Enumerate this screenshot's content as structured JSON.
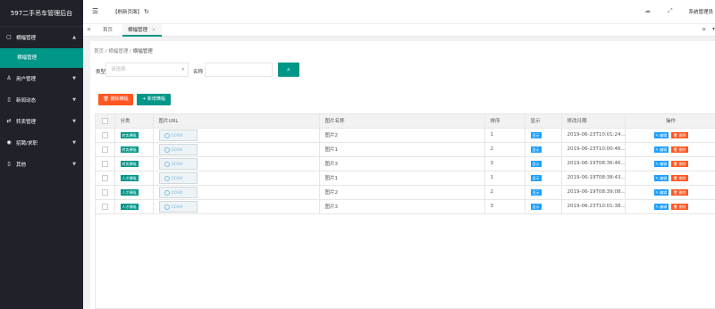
{
  "app": {
    "title": "597二手吊车管理后台"
  },
  "sidebar": {
    "items": [
      {
        "label": "横幅管理",
        "icon": "file-icon",
        "arrow": "▲",
        "open": true
      },
      {
        "label": "用户管理",
        "icon": "user-icon",
        "arrow": "▼"
      },
      {
        "label": "新闻动态",
        "icon": "doc-icon",
        "arrow": "▼"
      },
      {
        "label": "转卖管理",
        "icon": "transfer-icon",
        "arrow": "▼"
      },
      {
        "label": "招聘/求职",
        "icon": "circle-icon",
        "arrow": "▼"
      },
      {
        "label": "其他",
        "icon": "doc-icon",
        "arrow": "▼"
      }
    ],
    "subitem": "横幅管理"
  },
  "header": {
    "refresh_label": "【刷新页面】",
    "sys_label": "系统管理员"
  },
  "tabs": {
    "home": "首页",
    "active": "横幅管理"
  },
  "breadcrumb": {
    "a": "首页",
    "b": "横幅管理",
    "c": "横幅管理",
    "sep": "/"
  },
  "filter": {
    "type_label": "类型",
    "type_placeholder": "请选择",
    "name_label": "名称"
  },
  "buttons": {
    "batch_delete": "删除横幅",
    "add": "新增横幅"
  },
  "table": {
    "headers": [
      "",
      "分类",
      "图片URL",
      "图片名称",
      "排序",
      "显示",
      "修改日期",
      "操作"
    ],
    "rows": [
      {
        "category": "转卖横幅",
        "name": "图片2",
        "order": "1",
        "show": "显示",
        "date": "2019-06-23T10:01:24...",
        "edit": "编辑",
        "del": "删除"
      },
      {
        "category": "转卖横幅",
        "name": "图片1",
        "order": "2",
        "show": "显示",
        "date": "2019-06-23T10:00:46...",
        "edit": "编辑",
        "del": "删除"
      },
      {
        "category": "转卖横幅",
        "name": "图片3",
        "order": "3",
        "show": "显示",
        "date": "2019-06-19T08:36:46...",
        "edit": "编辑",
        "del": "删除"
      },
      {
        "category": "人才横幅",
        "name": "图片1",
        "order": "1",
        "show": "显示",
        "date": "2019-06-19T08:38:43...",
        "edit": "编辑",
        "del": "删除"
      },
      {
        "category": "人才横幅",
        "name": "图片2",
        "order": "2",
        "show": "显示",
        "date": "2019-06-19T08:39:08...",
        "edit": "编辑",
        "del": "删除"
      },
      {
        "category": "人才横幅",
        "name": "图片3",
        "order": "3",
        "show": "显示",
        "date": "2019-06-23T10:01:38...",
        "edit": "编辑",
        "del": "删除"
      }
    ],
    "thumb_text": "QOSW"
  },
  "colors": {
    "accent": "#009688",
    "danger": "#ff5722",
    "info": "#1e9fff",
    "sidebar": "#20222a"
  }
}
